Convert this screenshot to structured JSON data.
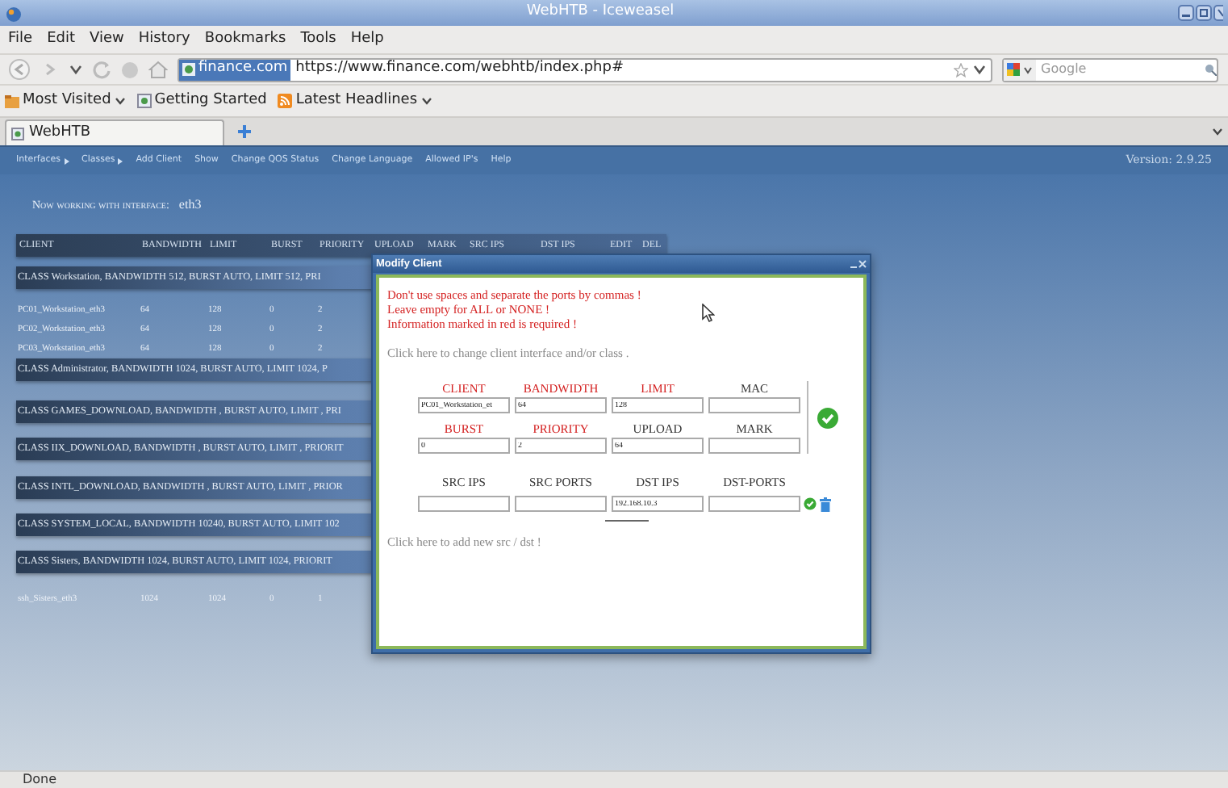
{
  "window": {
    "title": "WebHTB - Iceweasel"
  },
  "menu": [
    "File",
    "Edit",
    "View",
    "History",
    "Bookmarks",
    "Tools",
    "Help"
  ],
  "nav": {
    "identity": "finance.com",
    "url": "https://www.finance.com/webhtb/index.php#",
    "search_placeholder": "Google"
  },
  "bookmarks": [
    {
      "label": "Most Visited",
      "kind": "folder",
      "dropdown": true
    },
    {
      "label": "Getting Started",
      "kind": "page",
      "dropdown": false
    },
    {
      "label": "Latest Headlines",
      "kind": "feed",
      "dropdown": true
    }
  ],
  "tabs": [
    {
      "label": "WebHTB",
      "selected": true
    }
  ],
  "app_menu": [
    {
      "label": "Interfaces",
      "submenu": true
    },
    {
      "label": "Classes",
      "submenu": true
    },
    {
      "label": "Add Client",
      "submenu": false
    },
    {
      "label": "Show",
      "submenu": false
    },
    {
      "label": "Change QOS Status",
      "submenu": false
    },
    {
      "label": "Change Language",
      "submenu": false
    },
    {
      "label": "Allowed IP's",
      "submenu": false
    },
    {
      "label": "Help",
      "submenu": false
    }
  ],
  "version": "Version: 2.9.25",
  "interface": {
    "label": "Now working with interface:",
    "value": "eth3"
  },
  "table": {
    "columns": [
      "CLIENT",
      "BANDWIDTH",
      "LIMIT",
      "BURST",
      "PRIORITY",
      "UPLOAD",
      "MARK",
      "SRC IPS",
      "DST IPS",
      "EDIT",
      "DEL"
    ],
    "rows": [
      {
        "kind": "class",
        "text": "CLASS Workstation, BANDWIDTH 512, BURST AUTO, LIMIT 512, PRI"
      },
      {
        "kind": "client",
        "cells": [
          "PC01_Workstation_eth3",
          "64",
          "128",
          "0",
          "2"
        ]
      },
      {
        "kind": "client",
        "cells": [
          "PC02_Workstation_eth3",
          "64",
          "128",
          "0",
          "2"
        ]
      },
      {
        "kind": "client",
        "cells": [
          "PC03_Workstation_eth3",
          "64",
          "128",
          "0",
          "2"
        ]
      },
      {
        "kind": "class",
        "text": "CLASS Administrator, BANDWIDTH 1024, BURST AUTO, LIMIT 1024, P"
      },
      {
        "kind": "class",
        "text": "CLASS GAMES_DOWNLOAD, BANDWIDTH , BURST AUTO, LIMIT , PRI"
      },
      {
        "kind": "class",
        "text": "CLASS IIX_DOWNLOAD, BANDWIDTH , BURST AUTO, LIMIT , PRIORIT"
      },
      {
        "kind": "class",
        "text": "CLASS INTL_DOWNLOAD, BANDWIDTH , BURST AUTO, LIMIT , PRIOR"
      },
      {
        "kind": "class",
        "text": "CLASS SYSTEM_LOCAL, BANDWIDTH 10240, BURST AUTO, LIMIT 102"
      },
      {
        "kind": "class",
        "text": "CLASS Sisters, BANDWIDTH 1024, BURST AUTO, LIMIT 1024, PRIORIT"
      },
      {
        "kind": "client",
        "cells": [
          "ssh_Sisters_eth3",
          "1024",
          "1024",
          "0",
          "1"
        ]
      }
    ]
  },
  "dialog": {
    "title": "Modify Client",
    "warnings": [
      "Don't use spaces and separate the ports by commas !",
      "Leave empty for ALL or NONE !",
      "Information marked in red is required !"
    ],
    "change_link": "Click here to change client interface and/or class .",
    "fields": [
      {
        "label": "CLIENT",
        "value": "PC01_Workstation_et",
        "required": true
      },
      {
        "label": "BANDWIDTH",
        "value": "64",
        "required": true
      },
      {
        "label": "LIMIT",
        "value": "128",
        "required": true
      },
      {
        "label": "MAC",
        "required": false
      },
      {
        "label": "BURST",
        "value": "0",
        "required": true
      },
      {
        "label": "PRIORITY",
        "value": "2",
        "required": true
      },
      {
        "label": "UPLOAD",
        "value": "64",
        "required": false
      },
      {
        "label": "MARK",
        "required": false
      }
    ],
    "ports": [
      {
        "label": "SRC IPS"
      },
      {
        "label": "SRC PORTS"
      },
      {
        "label": "DST IPS",
        "value": "192.168.10.3"
      },
      {
        "label": "DST-PORTS"
      }
    ],
    "add_link": "Click here to add new src / dst !"
  },
  "status_bar": "Done"
}
